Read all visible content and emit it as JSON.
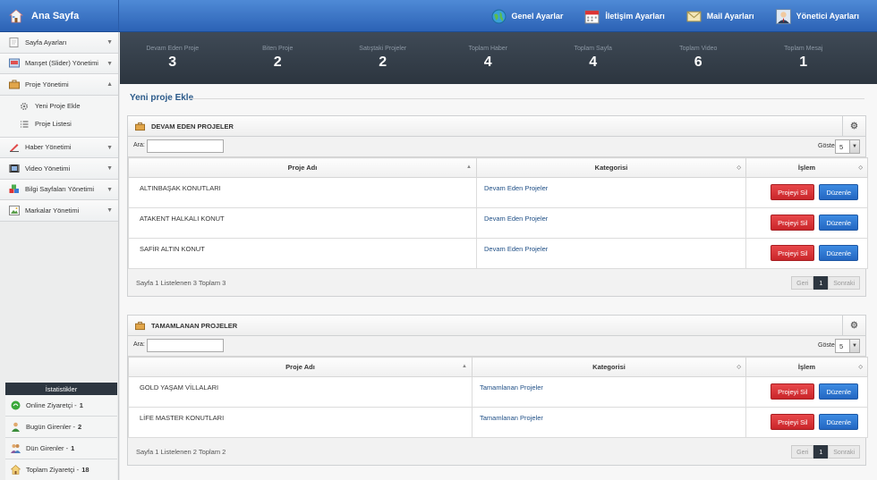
{
  "brand": {
    "title": "Ana Sayfa"
  },
  "topnav": [
    {
      "label": "Genel Ayarlar",
      "icon": "globe-icon"
    },
    {
      "label": "İletişim Ayarları",
      "icon": "calendar-icon"
    },
    {
      "label": "Mail Ayarları",
      "icon": "envelope-icon"
    },
    {
      "label": "Yönetici Ayarları",
      "icon": "admin-user-icon"
    }
  ],
  "sidebar": {
    "items": [
      {
        "label": "Sayfa Ayarları",
        "chevron": "▼"
      },
      {
        "label": "Manşet (Slider) Yönetimi",
        "chevron": "▼"
      },
      {
        "label": "Proje Yönetimi",
        "chevron": "▲"
      },
      {
        "label": "Haber Yönetimi",
        "chevron": "▼"
      },
      {
        "label": "Video Yönetimi",
        "chevron": "▼"
      },
      {
        "label": "Bilgi Sayfaları Yönetimi",
        "chevron": "▼"
      },
      {
        "label": "Markalar Yönetimi",
        "chevron": "▼"
      }
    ],
    "sub": [
      {
        "label": "Yeni Proje Ekle"
      },
      {
        "label": "Proje Listesi"
      }
    ]
  },
  "stats": {
    "title": "İstatistikler",
    "rows": [
      {
        "label": "Online Ziyaretçi -",
        "value": "1"
      },
      {
        "label": "Bugün Girenler -",
        "value": "2"
      },
      {
        "label": "Dün Girenler -",
        "value": "1"
      },
      {
        "label": "Toplam Ziyaretçi -",
        "value": "18"
      }
    ]
  },
  "strip": [
    {
      "label": "Devam Eden Proje",
      "value": "3"
    },
    {
      "label": "Biten Proje",
      "value": "2"
    },
    {
      "label": "Satıştaki Projeler",
      "value": "2"
    },
    {
      "label": "Toplam Haber",
      "value": "4"
    },
    {
      "label": "Toplam Sayfa",
      "value": "4"
    },
    {
      "label": "Toplam Video",
      "value": "6"
    },
    {
      "label": "Toplam Mesaj",
      "value": "1"
    }
  ],
  "page": {
    "title": "Yeni proje Ekle"
  },
  "labels": {
    "search": "Ara:",
    "show": "Göster:",
    "show_value": "5",
    "col_name": "Proje Adı",
    "col_cat": "Kategorisi",
    "col_action": "İşlem",
    "btn_delete": "Projeyi Sil",
    "btn_edit": "Düzenle",
    "prev": "Geri",
    "next": "Sonraki",
    "page": "1"
  },
  "panels": [
    {
      "title": "DEVAM EDEN PROJELER",
      "info": "Sayfa 1 Listelenen 3 Toplam 3",
      "rows": [
        {
          "name": "ALTINBAŞAK KONUTLARI",
          "cat": "Devam Eden Projeler"
        },
        {
          "name": "ATAKENT HALKALI KONUT",
          "cat": "Devam Eden Projeler"
        },
        {
          "name": "SAFİR ALTIN KONUT",
          "cat": "Devam Eden Projeler"
        }
      ]
    },
    {
      "title": "TAMAMLANAN PROJELER",
      "info": "Sayfa 1 Listelenen 2 Toplam 2",
      "rows": [
        {
          "name": "GOLD YAŞAM VİLLALARI",
          "cat": "Tamamlanan Projeler"
        },
        {
          "name": "LİFE MASTER KONUTLARI",
          "cat": "Tamamlanan Projeler"
        }
      ]
    }
  ]
}
